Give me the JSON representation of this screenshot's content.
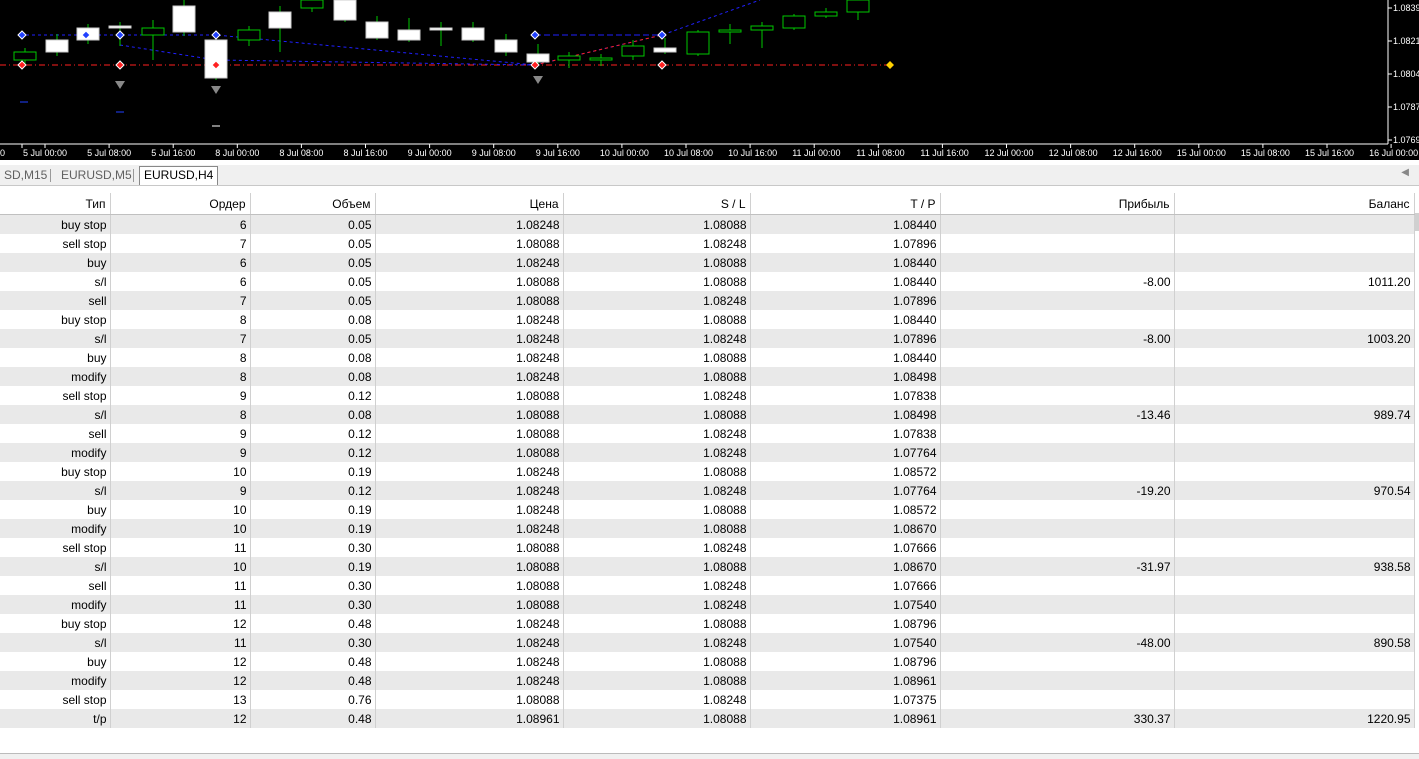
{
  "chart": {
    "price_labels": [
      "1.0839",
      "1.0821",
      "1.0804",
      "1.0787",
      "1.0769"
    ],
    "time_labels": [
      "0",
      "5 Jul 00:00",
      "5 Jul 08:00",
      "5 Jul 16:00",
      "8 Jul 00:00",
      "8 Jul 08:00",
      "8 Jul 16:00",
      "9 Jul 00:00",
      "9 Jul 08:00",
      "9 Jul 16:00",
      "10 Jul 00:00",
      "10 Jul 08:00",
      "10 Jul 16:00",
      "11 Jul 00:00",
      "11 Jul 08:00",
      "11 Jul 16:00",
      "12 Jul 00:00",
      "12 Jul 08:00",
      "12 Jul 16:00",
      "15 Jul 00:00",
      "15 Jul 08:00",
      "15 Jul 16:00",
      "16 Jul 00:00"
    ],
    "bull_color": "#00c800",
    "bear_color": "#ffffff",
    "background": "#000000"
  },
  "tabs": [
    "SD,M15",
    "EURUSD,M5",
    "EURUSD,H4"
  ],
  "table": {
    "headers": [
      "Тип",
      "Ордер",
      "Объем",
      "Цена",
      "S / L",
      "T / P",
      "Прибыль",
      "Баланс"
    ],
    "rows": [
      [
        "buy stop",
        "6",
        "0.05",
        "1.08248",
        "1.08088",
        "1.08440",
        "",
        ""
      ],
      [
        "sell stop",
        "7",
        "0.05",
        "1.08088",
        "1.08248",
        "1.07896",
        "",
        ""
      ],
      [
        "buy",
        "6",
        "0.05",
        "1.08248",
        "1.08088",
        "1.08440",
        "",
        ""
      ],
      [
        "s/l",
        "6",
        "0.05",
        "1.08088",
        "1.08088",
        "1.08440",
        "-8.00",
        "1011.20"
      ],
      [
        "sell",
        "7",
        "0.05",
        "1.08088",
        "1.08248",
        "1.07896",
        "",
        ""
      ],
      [
        "buy stop",
        "8",
        "0.08",
        "1.08248",
        "1.08088",
        "1.08440",
        "",
        ""
      ],
      [
        "s/l",
        "7",
        "0.05",
        "1.08248",
        "1.08248",
        "1.07896",
        "-8.00",
        "1003.20"
      ],
      [
        "buy",
        "8",
        "0.08",
        "1.08248",
        "1.08088",
        "1.08440",
        "",
        ""
      ],
      [
        "modify",
        "8",
        "0.08",
        "1.08248",
        "1.08088",
        "1.08498",
        "",
        ""
      ],
      [
        "sell stop",
        "9",
        "0.12",
        "1.08088",
        "1.08248",
        "1.07838",
        "",
        ""
      ],
      [
        "s/l",
        "8",
        "0.08",
        "1.08088",
        "1.08088",
        "1.08498",
        "-13.46",
        "989.74"
      ],
      [
        "sell",
        "9",
        "0.12",
        "1.08088",
        "1.08248",
        "1.07838",
        "",
        ""
      ],
      [
        "modify",
        "9",
        "0.12",
        "1.08088",
        "1.08248",
        "1.07764",
        "",
        ""
      ],
      [
        "buy stop",
        "10",
        "0.19",
        "1.08248",
        "1.08088",
        "1.08572",
        "",
        ""
      ],
      [
        "s/l",
        "9",
        "0.12",
        "1.08248",
        "1.08248",
        "1.07764",
        "-19.20",
        "970.54"
      ],
      [
        "buy",
        "10",
        "0.19",
        "1.08248",
        "1.08088",
        "1.08572",
        "",
        ""
      ],
      [
        "modify",
        "10",
        "0.19",
        "1.08248",
        "1.08088",
        "1.08670",
        "",
        ""
      ],
      [
        "sell stop",
        "11",
        "0.30",
        "1.08088",
        "1.08248",
        "1.07666",
        "",
        ""
      ],
      [
        "s/l",
        "10",
        "0.19",
        "1.08088",
        "1.08088",
        "1.08670",
        "-31.97",
        "938.58"
      ],
      [
        "sell",
        "11",
        "0.30",
        "1.08088",
        "1.08248",
        "1.07666",
        "",
        ""
      ],
      [
        "modify",
        "11",
        "0.30",
        "1.08088",
        "1.08248",
        "1.07540",
        "",
        ""
      ],
      [
        "buy stop",
        "12",
        "0.48",
        "1.08248",
        "1.08088",
        "1.08796",
        "",
        ""
      ],
      [
        "s/l",
        "11",
        "0.30",
        "1.08248",
        "1.08248",
        "1.07540",
        "-48.00",
        "890.58"
      ],
      [
        "buy",
        "12",
        "0.48",
        "1.08248",
        "1.08088",
        "1.08796",
        "",
        ""
      ],
      [
        "modify",
        "12",
        "0.48",
        "1.08248",
        "1.08088",
        "1.08961",
        "",
        ""
      ],
      [
        "sell stop",
        "13",
        "0.76",
        "1.08088",
        "1.08248",
        "1.07375",
        "",
        ""
      ],
      [
        "t/p",
        "12",
        "0.48",
        "1.08961",
        "1.08088",
        "1.08961",
        "330.37",
        "1220.95"
      ]
    ]
  }
}
